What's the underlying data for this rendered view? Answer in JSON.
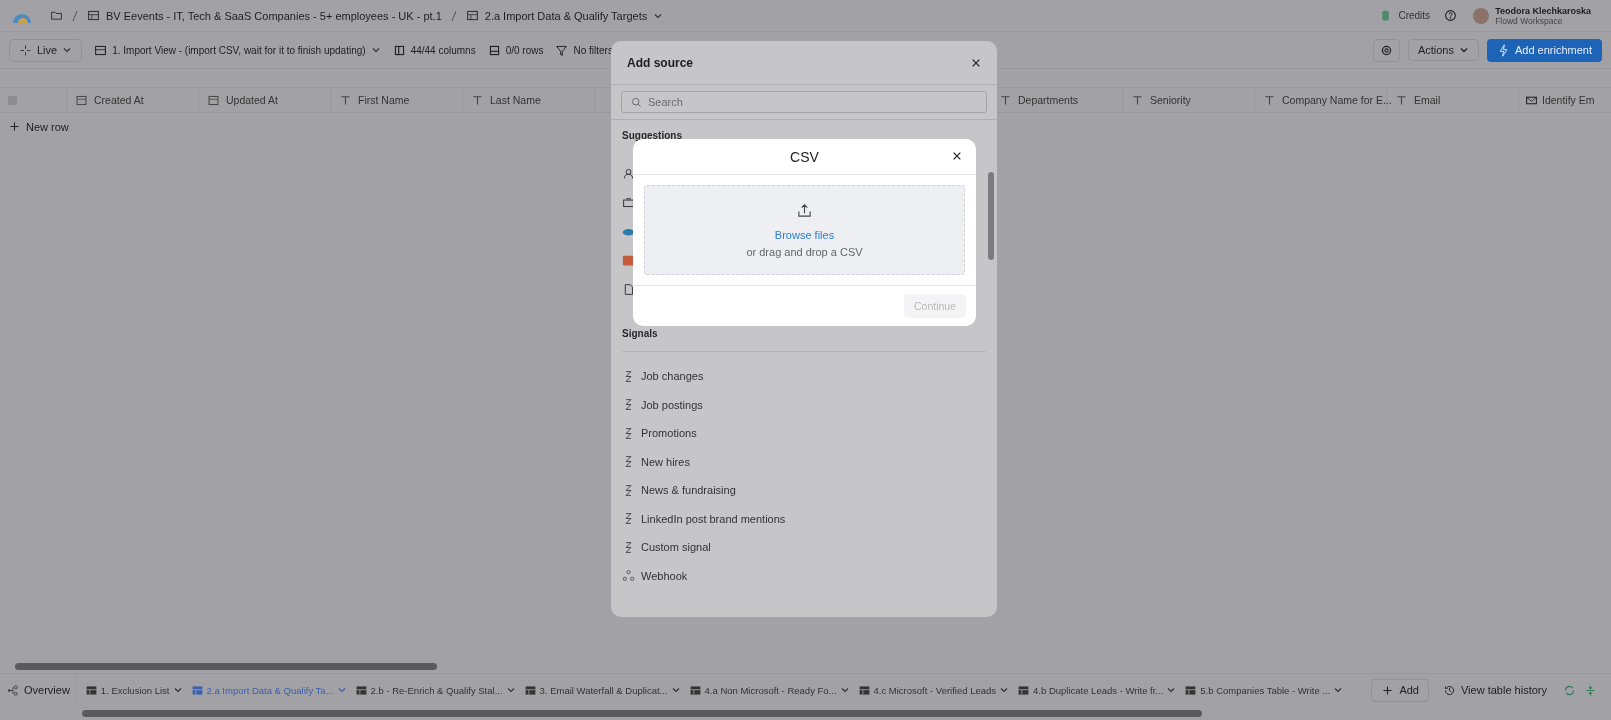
{
  "breadcrumb": {
    "items": [
      "BV Eevents - IT, Tech & SaaS Companies - 5+ employees - UK - pt.1",
      "2.a Import Data & Qualify Targets"
    ]
  },
  "account": {
    "credits": "Credits",
    "name": "Teodora Klechkaroska",
    "workspace": "Flowd Workspace"
  },
  "toolbar": {
    "mode": "Live",
    "view": "1. Import View - (import CSV, wait for it to finish updating)",
    "columns": "44/44 columns",
    "rows": "0/0 rows",
    "filters": "No filters",
    "actions": "Actions",
    "add_enrichment": "Add enrichment"
  },
  "table": {
    "select_all": {
      "checked": false
    },
    "columns": [
      {
        "label": "Created At",
        "kind": "date"
      },
      {
        "label": "Updated At",
        "kind": "date"
      },
      {
        "label": "First Name",
        "kind": "text"
      },
      {
        "label": "Last Name",
        "kind": "text"
      },
      {
        "kind": "covered"
      },
      {
        "label": "Departments",
        "kind": "text"
      },
      {
        "label": "Seniority",
        "kind": "text"
      },
      {
        "label": "Company Name for E...",
        "kind": "text"
      },
      {
        "label": "Email",
        "kind": "text"
      },
      {
        "label": "Identify Em",
        "kind": "mail"
      }
    ],
    "new_row": "New row"
  },
  "add_source": {
    "title": "Add source",
    "search": {
      "placeholder": "Search"
    },
    "suggestions_heading": "Suggestions",
    "suggestions": [
      {
        "kind": "person"
      },
      {
        "kind": "briefcase"
      },
      {
        "kind": "cloud"
      },
      {
        "kind": "app"
      },
      {
        "kind": "document"
      }
    ],
    "signals_heading": "Signals",
    "signals": [
      {
        "label": "Job changes",
        "kind": "signal"
      },
      {
        "label": "Job postings",
        "kind": "signal"
      },
      {
        "label": "Promotions",
        "kind": "signal"
      },
      {
        "label": "New hires",
        "kind": "signal"
      },
      {
        "label": "News & fundraising",
        "kind": "signal"
      },
      {
        "label": "LinkedIn post brand mentions",
        "kind": "signal"
      },
      {
        "label": "Custom signal",
        "kind": "signal"
      },
      {
        "label": "Webhook",
        "kind": "webhook"
      }
    ]
  },
  "csv_dialog": {
    "title": "CSV",
    "browse": "Browse files",
    "hint": "or drag and drop a CSV",
    "continue": {
      "label": "Continue",
      "disabled": true
    }
  },
  "bottom_bar": {
    "overview": "Overview",
    "tabs": [
      {
        "label": "1. Exclusion List",
        "selected": false
      },
      {
        "label": "2.a Import Data & Qualify Ta...",
        "selected": true
      },
      {
        "label": "2.b - Re-Enrich & Qualify Stal...",
        "selected": false
      },
      {
        "label": "3. Email Waterfall & Duplicat...",
        "selected": false
      },
      {
        "label": "4.a Non Microsoft - Ready Fo...",
        "selected": false
      },
      {
        "label": "4.c Microsoft - Verified Leads",
        "selected": false
      },
      {
        "label": "4.b Duplicate Leads - Write fr...",
        "selected": false
      },
      {
        "label": "5.b Companies Table - Write ...",
        "selected": false
      }
    ],
    "add": "Add",
    "history": "View table history"
  }
}
